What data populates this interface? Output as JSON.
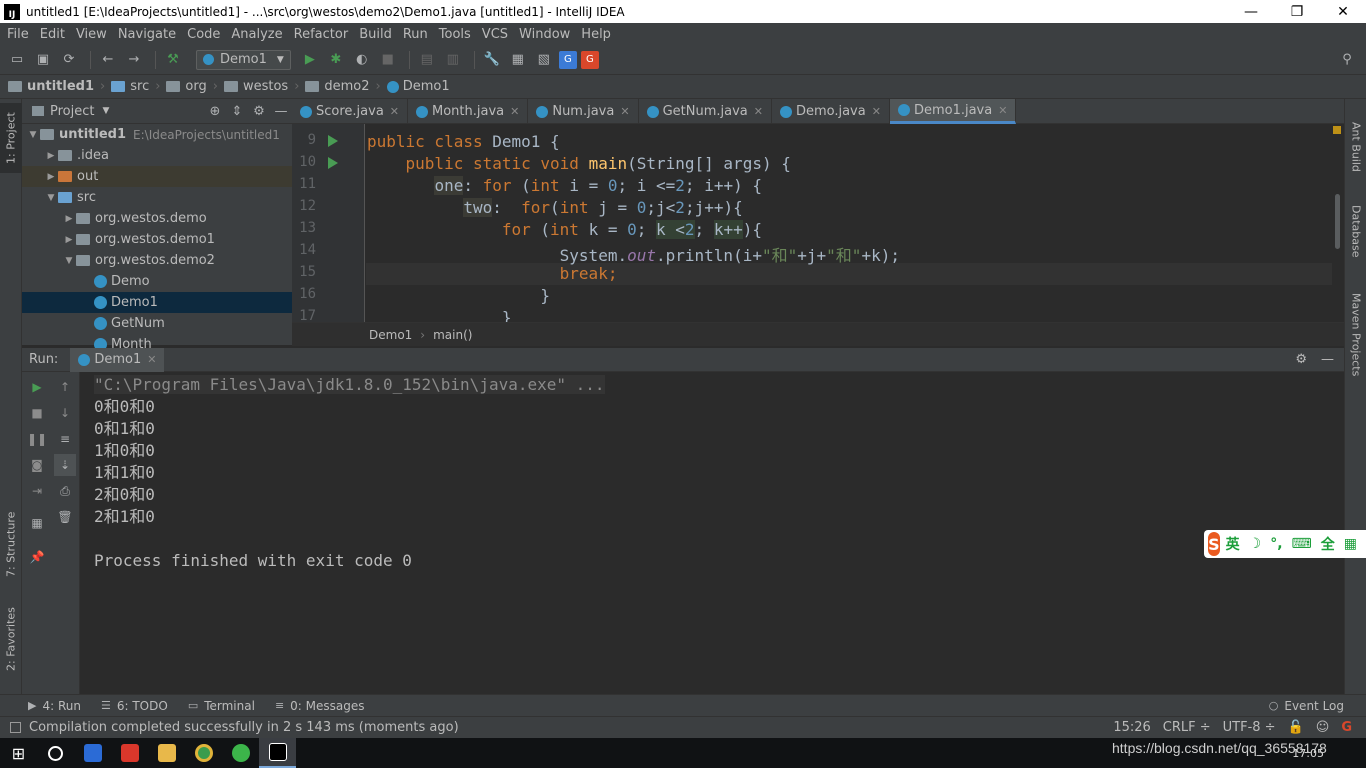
{
  "window": {
    "title": "untitled1 [E:\\IdeaProjects\\untitled1] - ...\\src\\org\\westos\\demo2\\Demo1.java [untitled1] - IntelliJ IDEA",
    "app_icon_text": "IJ",
    "controls": [
      "—",
      "❐",
      "✕"
    ]
  },
  "menu": [
    "File",
    "Edit",
    "View",
    "Navigate",
    "Code",
    "Analyze",
    "Refactor",
    "Build",
    "Run",
    "Tools",
    "VCS",
    "Window",
    "Help"
  ],
  "toolbar": {
    "run_config": "Demo1"
  },
  "breadcrumb": [
    "untitled1",
    "src",
    "org",
    "westos",
    "demo2",
    "Demo1"
  ],
  "left_strip": {
    "project": "1: Project",
    "structure": "7: Structure",
    "favorites": "2: Favorites"
  },
  "right_strip": {
    "ant": "Ant Build",
    "database": "Database",
    "maven": "Maven Projects"
  },
  "project_panel": {
    "title": "Project",
    "tree": [
      {
        "label": "untitled1",
        "detail": "E:\\IdeaProjects\\untitled1",
        "arrow": "▼",
        "icon": "folder",
        "bold": true,
        "indent": 0
      },
      {
        "label": ".idea",
        "arrow": "▶",
        "icon": "folder",
        "indent": 1
      },
      {
        "label": "out",
        "arrow": "▶",
        "icon": "folder-orange",
        "indent": 1
      },
      {
        "label": "src",
        "arrow": "▼",
        "icon": "folder-blue",
        "indent": 1
      },
      {
        "label": "org.westos.demo",
        "arrow": "▶",
        "icon": "package",
        "indent": 2
      },
      {
        "label": "org.westos.demo1",
        "arrow": "▶",
        "icon": "package",
        "indent": 2
      },
      {
        "label": "org.westos.demo2",
        "arrow": "▼",
        "icon": "package",
        "indent": 2
      },
      {
        "label": "Demo",
        "arrow": "",
        "icon": "class",
        "indent": 3
      },
      {
        "label": "Demo1",
        "arrow": "",
        "icon": "class",
        "indent": 3,
        "selected": true
      },
      {
        "label": "GetNum",
        "arrow": "",
        "icon": "class",
        "indent": 3
      },
      {
        "label": "Month",
        "arrow": "",
        "icon": "class",
        "indent": 3
      }
    ]
  },
  "editor_tabs": [
    {
      "label": "Score.java",
      "active": false
    },
    {
      "label": "Month.java",
      "active": false
    },
    {
      "label": "Num.java",
      "active": false
    },
    {
      "label": "GetNum.java",
      "active": false
    },
    {
      "label": "Demo.java",
      "active": false
    },
    {
      "label": "Demo1.java",
      "active": true
    }
  ],
  "editor": {
    "line_numbers": [
      "9",
      "10",
      "11",
      "12",
      "13",
      "14",
      "15",
      "16",
      "17"
    ],
    "breadcrumbs": [
      "Demo1",
      "main()"
    ]
  },
  "run_panel": {
    "label": "Run:",
    "tab": "Demo1",
    "output": [
      "\"C:\\Program Files\\Java\\jdk1.8.0_152\\bin\\java.exe\" ...",
      "0和0和0",
      "0和1和0",
      "1和0和0",
      "1和1和0",
      "2和0和0",
      "2和1和0",
      "",
      "Process finished with exit code 0"
    ]
  },
  "bottom_tabs": [
    "4: Run",
    "6: TODO",
    "Terminal",
    "0: Messages"
  ],
  "event_log": "Event Log",
  "status": {
    "message": "Compilation completed successfully in 2 s 143 ms (moments ago)",
    "position": "15:26",
    "line_sep": "CRLF ÷",
    "encoding": "UTF-8 ÷"
  },
  "ime": {
    "logo": "S",
    "items": [
      "英",
      "☽",
      "°,",
      "⌨",
      "全",
      "▦"
    ]
  },
  "taskbar": {
    "time": "17:05"
  },
  "watermark": "https://blog.csdn.net/qq_36558178"
}
